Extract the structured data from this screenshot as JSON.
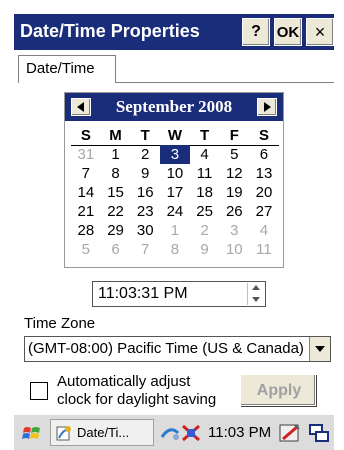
{
  "window": {
    "title": "Date/Time Properties",
    "help_label": "?",
    "ok_label": "OK",
    "close_label": "×"
  },
  "tabs": [
    {
      "label": "Date/Time",
      "selected": true
    }
  ],
  "calendar": {
    "month_label": "September 2008",
    "weekdays": [
      "S",
      "M",
      "T",
      "W",
      "T",
      "F",
      "S"
    ],
    "weeks": [
      [
        "31",
        "1",
        "2",
        "3",
        "4",
        "5",
        "6"
      ],
      [
        "7",
        "8",
        "9",
        "10",
        "11",
        "12",
        "13"
      ],
      [
        "14",
        "15",
        "16",
        "17",
        "18",
        "19",
        "20"
      ],
      [
        "21",
        "22",
        "23",
        "24",
        "25",
        "26",
        "27"
      ],
      [
        "28",
        "29",
        "30",
        "1",
        "2",
        "3",
        "4"
      ],
      [
        "5",
        "6",
        "7",
        "8",
        "9",
        "10",
        "11"
      ]
    ],
    "selected_day": "3"
  },
  "time": {
    "value": "11:03:31 PM"
  },
  "timezone": {
    "label": "Time Zone",
    "value": "(GMT-08:00) Pacific Time (US & Canada)"
  },
  "daylight": {
    "label_line1": "Automatically adjust",
    "label_line2": "clock for daylight saving",
    "checked": false
  },
  "apply_label": "Apply",
  "taskbar": {
    "task_label": "Date/Ti...",
    "clock": "11:03 PM"
  },
  "colors": {
    "title_bar": "#1a2d7a",
    "selection": "#1a2d7a",
    "dim_day": "#a8a8a8",
    "disabled_text": "#a0a0a0"
  }
}
